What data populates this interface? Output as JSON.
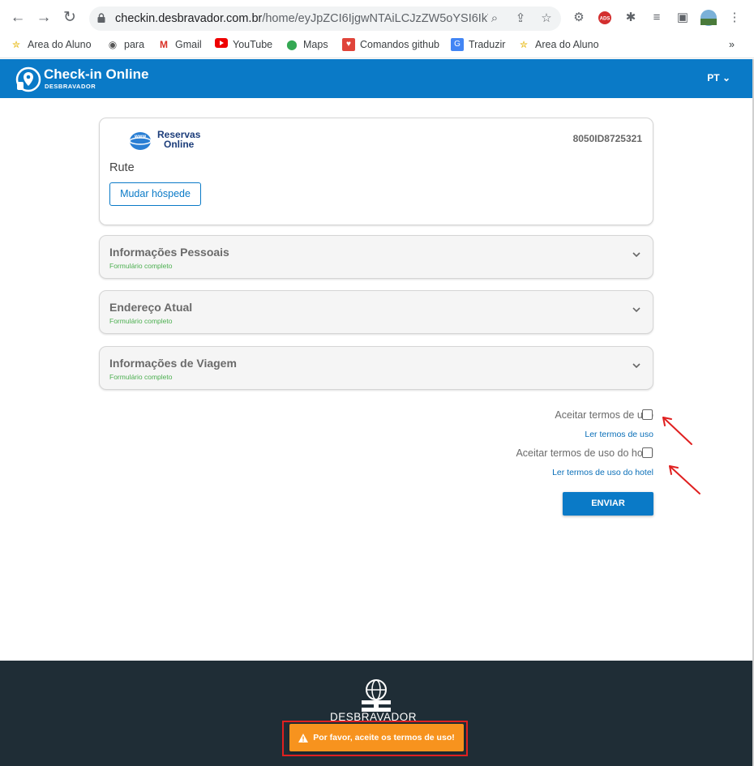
{
  "browser": {
    "url_host": "checkin.desbravador.com.br",
    "url_path": "/home/eyJpZCI6IjgwNTAiLCJzZW5oYSI6IkV...",
    "bookmarks": [
      {
        "label": "Area do Aluno",
        "icon": "star-icon"
      },
      {
        "label": "para",
        "icon": "globe-icon"
      },
      {
        "label": "Gmail",
        "icon": "gmail-icon"
      },
      {
        "label": "YouTube",
        "icon": "youtube-icon"
      },
      {
        "label": "Maps",
        "icon": "maps-icon"
      },
      {
        "label": "Comandos github",
        "icon": "heart-icon"
      },
      {
        "label": "Traduzir",
        "icon": "translate-icon"
      },
      {
        "label": "Area do Aluno",
        "icon": "star-icon"
      }
    ],
    "more_bookmarks": "»"
  },
  "header": {
    "title": "Check-in Online",
    "subtitle": "DESBRAVADOR",
    "language": "PT"
  },
  "reservation": {
    "logo_text_1": "Reservas",
    "logo_text_2": "Online",
    "code": "8050ID8725321",
    "guest_name": "Rute",
    "change_guest_label": "Mudar hóspede"
  },
  "sections": [
    {
      "title": "Informações Pessoais",
      "status": "Formulário completo"
    },
    {
      "title": "Endereço Atual",
      "status": "Formulário completo"
    },
    {
      "title": "Informações de Viagem",
      "status": "Formulário completo"
    }
  ],
  "terms": {
    "accept_terms": "Aceitar termos de uso",
    "read_terms": "Ler termos de uso",
    "accept_hotel_terms": "Aceitar termos de uso do hotel",
    "read_hotel_terms": "Ler termos de uso do hotel",
    "accept_terms_checked": false,
    "accept_hotel_terms_checked": false
  },
  "submit_label": "ENVIAR",
  "footer": {
    "brand": "DESBRAVADOR"
  },
  "toast": {
    "message": "Por favor, aceite os termos de uso!"
  },
  "colors": {
    "primary": "#0a7ac7",
    "footer_bg": "#1f2d36",
    "toast_bg": "#f7931e",
    "status_green": "#4caf50",
    "annotation_red": "#e02020"
  }
}
